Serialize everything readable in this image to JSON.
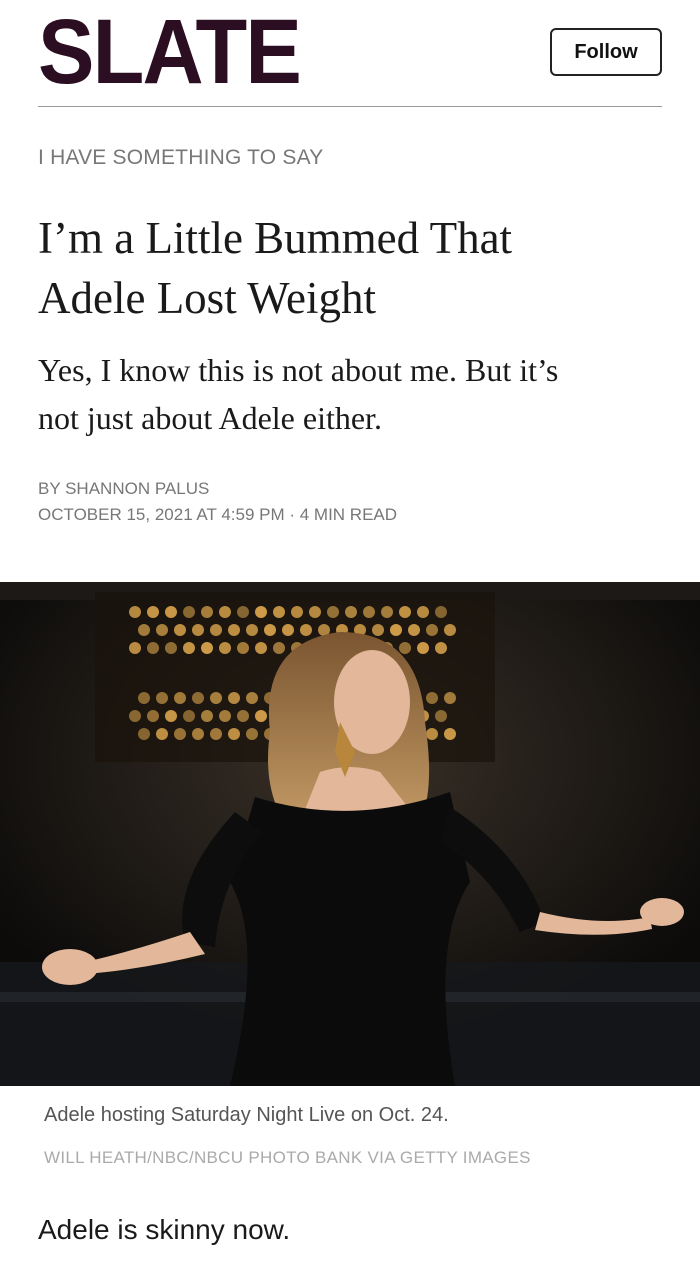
{
  "header": {
    "logo_text": "SLATE",
    "follow_label": "Follow"
  },
  "article": {
    "kicker": "I HAVE SOMETHING TO SAY",
    "headline_line1": "I’m a Little Bummed That",
    "headline_line2": "Adele Lost Weight",
    "dek_line1": "Yes, I know this is not about me. But it’s",
    "dek_line2": "not just about Adele either.",
    "byline": "BY SHANNON PALUS",
    "dateline": "OCTOBER 15, 2021 AT 4:59 PM · 4 MIN READ",
    "body_first_line": "Adele is skinny now."
  },
  "photo": {
    "caption": "Adele hosting Saturday Night Live on Oct. 24.",
    "credit": "WILL HEATH/NBC/NBCU PHOTO BANK VIA GETTY IMAGES"
  },
  "colors": {
    "brand": "#2b0e22",
    "meta_gray": "#777777",
    "credit_gray": "#aaaaaa"
  }
}
